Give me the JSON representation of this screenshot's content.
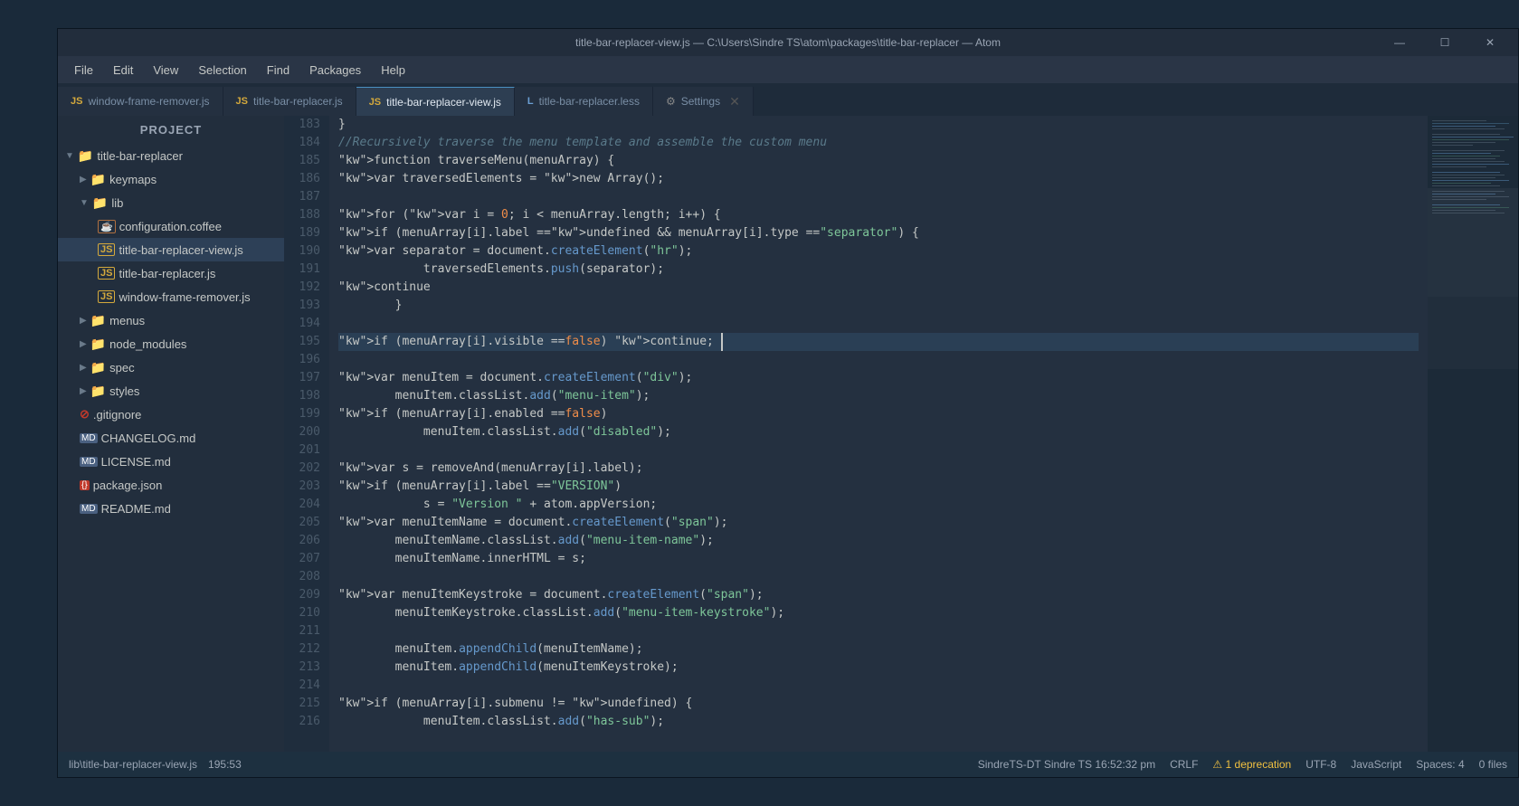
{
  "window": {
    "title": "title-bar-replacer-view.js — C:\\Users\\Sindre TS\\atom\\packages\\title-bar-replacer — Atom"
  },
  "controls": {
    "minimize": "—",
    "maximize": "☐",
    "close": "✕"
  },
  "menu": {
    "items": [
      "File",
      "Edit",
      "View",
      "Selection",
      "Find",
      "Packages",
      "Help"
    ]
  },
  "tabs": [
    {
      "id": "window-frame-remover",
      "label": "window-frame-remover.js",
      "type": "js",
      "active": false,
      "closeable": false
    },
    {
      "id": "title-bar-replacer",
      "label": "title-bar-replacer.js",
      "type": "js",
      "active": false,
      "closeable": false
    },
    {
      "id": "title-bar-replacer-view",
      "label": "title-bar-replacer-view.js",
      "type": "js",
      "active": true,
      "closeable": false
    },
    {
      "id": "title-bar-replacer-less",
      "label": "title-bar-replacer.less",
      "type": "less",
      "active": false,
      "closeable": false
    },
    {
      "id": "settings",
      "label": "Settings",
      "type": "settings",
      "active": false,
      "closeable": true
    }
  ],
  "sidebar": {
    "title": "Project",
    "tree": [
      {
        "level": 0,
        "type": "folder",
        "open": true,
        "label": "title-bar-replacer"
      },
      {
        "level": 1,
        "type": "folder",
        "open": false,
        "label": "keymaps"
      },
      {
        "level": 1,
        "type": "folder",
        "open": true,
        "label": "lib"
      },
      {
        "level": 2,
        "type": "coffee",
        "label": "configuration.coffee"
      },
      {
        "level": 2,
        "type": "js",
        "label": "title-bar-replacer-view.js",
        "selected": true
      },
      {
        "level": 2,
        "type": "js",
        "label": "title-bar-replacer.js"
      },
      {
        "level": 2,
        "type": "js",
        "label": "window-frame-remover.js"
      },
      {
        "level": 1,
        "type": "folder",
        "open": false,
        "label": "menus"
      },
      {
        "level": 1,
        "type": "folder",
        "open": false,
        "label": "node_modules"
      },
      {
        "level": 1,
        "type": "folder",
        "open": false,
        "label": "spec"
      },
      {
        "level": 1,
        "type": "folder",
        "open": false,
        "label": "styles"
      },
      {
        "level": 1,
        "type": "gitignore",
        "label": ".gitignore"
      },
      {
        "level": 1,
        "type": "md",
        "label": "CHANGELOG.md"
      },
      {
        "level": 1,
        "type": "md",
        "label": "LICENSE.md"
      },
      {
        "level": 1,
        "type": "json",
        "label": "package.json"
      },
      {
        "level": 1,
        "type": "md",
        "label": "README.md"
      }
    ]
  },
  "code": {
    "lines": [
      {
        "num": 183,
        "content": "}"
      },
      {
        "num": 184,
        "content": "//Recursively traverse the menu template and assemble the custom menu",
        "comment": true
      },
      {
        "num": 185,
        "content": "function traverseMenu(menuArray) {",
        "highlighted": false
      },
      {
        "num": 186,
        "content": "    var traversedElements = new Array();",
        "highlighted": false
      },
      {
        "num": 187,
        "content": ""
      },
      {
        "num": 188,
        "content": "    for (var i = 0; i < menuArray.length; i++) {",
        "highlighted": false
      },
      {
        "num": 189,
        "content": "        if (menuArray[i].label == undefined && menuArray[i].type == \"separator\") {",
        "highlighted": false
      },
      {
        "num": 190,
        "content": "            var separator = document.createElement(\"hr\");",
        "highlighted": false
      },
      {
        "num": 191,
        "content": "            traversedElements.push(separator);",
        "highlighted": false
      },
      {
        "num": 192,
        "content": "            continue",
        "highlighted": false
      },
      {
        "num": 193,
        "content": "        }",
        "highlighted": false
      },
      {
        "num": 194,
        "content": ""
      },
      {
        "num": 195,
        "content": "        if (menuArray[i].visible == false) continue;",
        "highlighted": true
      },
      {
        "num": 196,
        "content": ""
      },
      {
        "num": 197,
        "content": "        var menuItem = document.createElement(\"div\");",
        "highlighted": false
      },
      {
        "num": 198,
        "content": "        menuItem.classList.add(\"menu-item\");",
        "highlighted": false
      },
      {
        "num": 199,
        "content": "        if (menuArray[i].enabled == false)",
        "highlighted": false
      },
      {
        "num": 200,
        "content": "            menuItem.classList.add(\"disabled\");",
        "highlighted": false
      },
      {
        "num": 201,
        "content": ""
      },
      {
        "num": 202,
        "content": "        var s = removeAnd(menuArray[i].label);",
        "highlighted": false
      },
      {
        "num": 203,
        "content": "        if (menuArray[i].label == \"VERSION\")",
        "highlighted": false
      },
      {
        "num": 204,
        "content": "            s = \"Version \" + atom.appVersion;",
        "highlighted": false
      },
      {
        "num": 205,
        "content": "        var menuItemName = document.createElement(\"span\");",
        "highlighted": false
      },
      {
        "num": 206,
        "content": "        menuItemName.classList.add(\"menu-item-name\");",
        "highlighted": false
      },
      {
        "num": 207,
        "content": "        menuItemName.innerHTML = s;",
        "highlighted": false
      },
      {
        "num": 208,
        "content": ""
      },
      {
        "num": 209,
        "content": "        var menuItemKeystroke = document.createElement(\"span\");",
        "highlighted": false
      },
      {
        "num": 210,
        "content": "        menuItemKeystroke.classList.add(\"menu-item-keystroke\");",
        "highlighted": false
      },
      {
        "num": 211,
        "content": ""
      },
      {
        "num": 212,
        "content": "        menuItem.appendChild(menuItemName);",
        "highlighted": false
      },
      {
        "num": 213,
        "content": "        menuItem.appendChild(menuItemKeystroke);",
        "highlighted": false
      },
      {
        "num": 214,
        "content": ""
      },
      {
        "num": 215,
        "content": "        if (menuArray[i].submenu != undefined) {",
        "highlighted": false
      },
      {
        "num": 216,
        "content": "            menuItem.classList.add(\"has-sub\");",
        "highlighted": false
      }
    ]
  },
  "status": {
    "left": {
      "path": "lib\\title-bar-replacer-view.js",
      "position": "195:53"
    },
    "right": {
      "line_endings": "CRLF",
      "warning": "⚠ 1 deprecation",
      "encoding": "UTF-8",
      "language": "JavaScript",
      "indent": "Spaces: 4",
      "files": "0 files",
      "user": "SindreTS-DT Sindre TS 16:52:32 pm"
    }
  }
}
